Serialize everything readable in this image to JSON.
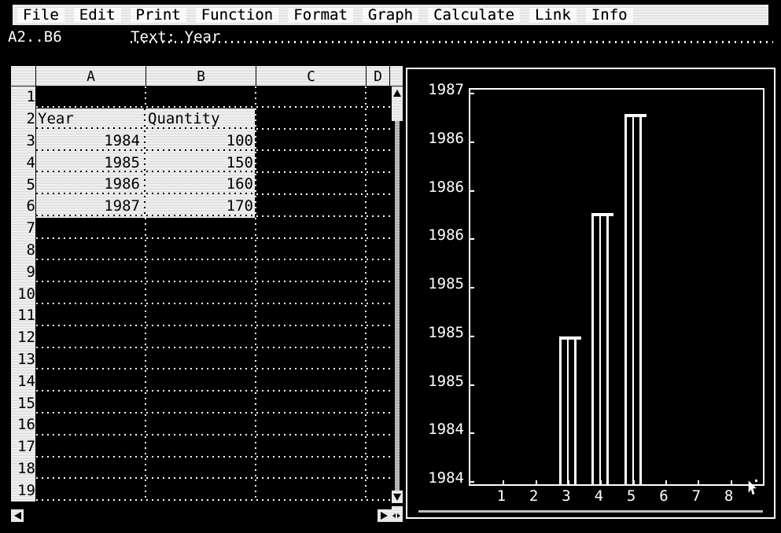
{
  "app": {
    "title": "Spreadsheet"
  },
  "menubar": {
    "items": [
      {
        "label": "File",
        "name": "menu-file"
      },
      {
        "label": "Edit",
        "name": "menu-edit"
      },
      {
        "label": "Print",
        "name": "menu-print"
      },
      {
        "label": "Function",
        "name": "menu-function"
      },
      {
        "label": "Format",
        "name": "menu-format"
      },
      {
        "label": "Graph",
        "name": "menu-graph"
      },
      {
        "label": "Calculate",
        "name": "menu-calculate"
      },
      {
        "label": "Link",
        "name": "menu-link"
      },
      {
        "label": "Info",
        "name": "menu-info"
      }
    ]
  },
  "statusline": {
    "cell_reference": "A2..B6",
    "cell_content": "Text: Year",
    "cursor_icon": "mouse-pointer-icon"
  },
  "sheet": {
    "column_headers": [
      "A",
      "B",
      "C",
      "D"
    ],
    "row_numbers": [
      "1",
      "2",
      "3",
      "4",
      "5",
      "6",
      "7",
      "8",
      "9",
      "10",
      "11",
      "12",
      "13",
      "14",
      "15",
      "16",
      "17",
      "18",
      "19"
    ],
    "selection_range": "A2..B6",
    "rows": [
      {
        "row": "2",
        "a": "Year",
        "b": "Quantity",
        "a_align": "left",
        "b_align": "left"
      },
      {
        "row": "3",
        "a": "1984",
        "b": "100",
        "a_align": "right",
        "b_align": "right"
      },
      {
        "row": "4",
        "a": "1985",
        "b": "150",
        "a_align": "right",
        "b_align": "right"
      },
      {
        "row": "5",
        "a": "1986",
        "b": "160",
        "a_align": "right",
        "b_align": "right"
      },
      {
        "row": "6",
        "a": "1987",
        "b": "170",
        "a_align": "right",
        "b_align": "right"
      }
    ],
    "vscroll": {
      "up_icon": "triangle-up-icon",
      "down_icon": "triangle-down-icon"
    },
    "hscroll": {
      "left_icon": "triangle-left-icon",
      "right_icon": "triangle-right-icon",
      "resize_icon": "resize-corner-icon"
    }
  },
  "chart_data": {
    "type": "bar",
    "title": "",
    "xlabel": "",
    "ylabel": "",
    "categories": [
      "1",
      "2",
      "3",
      "4",
      "5",
      "6",
      "7",
      "8"
    ],
    "values": [
      0,
      0,
      1985.2,
      1986.2,
      1987.0,
      0,
      0,
      0
    ],
    "series": [
      {
        "name": "Year",
        "values": [
          0,
          0,
          1985.2,
          1986.2,
          1987.0,
          0,
          0,
          0
        ]
      }
    ],
    "ytick_labels": [
      "1987",
      "1986",
      "1986",
      "1986",
      "1985",
      "1985",
      "1985",
      "1984",
      "1984"
    ],
    "xtick_labels": [
      "1",
      "2",
      "3",
      "4",
      "5",
      "6",
      "7",
      "8"
    ],
    "ylim": [
      1984.0,
      1987.2
    ],
    "xlim": [
      0.5,
      8.5
    ],
    "grid": false,
    "legend": false,
    "bar_color": "#ffffff",
    "background": "#000000"
  },
  "colors": {
    "background": "#000000",
    "panel": "#e8e8e8",
    "foreground": "#ffffff",
    "text": "#000000"
  }
}
